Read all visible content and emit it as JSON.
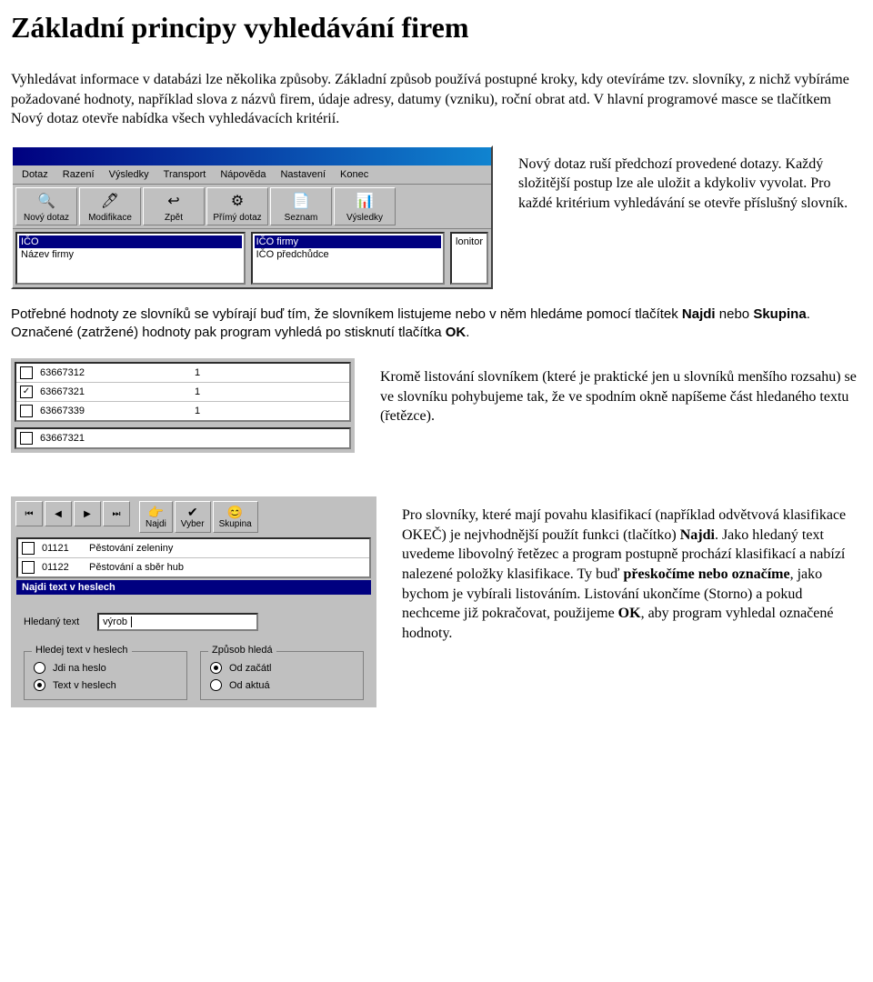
{
  "title": "Základní principy vyhledávání firem",
  "intro": "Vyhledávat informace v databázi lze několika způsoby. Základní způsob používá postupné kroky, kdy otevíráme tzv. slovníky, z nichž vybíráme požadované hodnoty, například slova z názvů firem, údaje adresy, datumy (vzniku), roční obrat atd. V hlavní programové masce se tlačítkem Nový dotaz otevře nabídka všech vyhledávacích kritérií.",
  "shot1": {
    "menu": [
      "Dotaz",
      "Razení",
      "Výsledky",
      "Transport",
      "Nápověda",
      "Nastavení",
      "Konec"
    ],
    "buttons": [
      {
        "label": "Nový dotaz",
        "icon": "🔍"
      },
      {
        "label": "Modifikace",
        "icon": "🖊"
      },
      {
        "label": "Zpět",
        "icon": "↩"
      },
      {
        "label": "Přímý dotaz",
        "icon": "⚙"
      },
      {
        "label": "Seznam",
        "icon": "📄"
      },
      {
        "label": "Výsledky",
        "icon": "📊"
      }
    ],
    "left_items": [
      "IČO",
      "Název firmy"
    ],
    "mid_items": [
      "IČO firmy",
      "IČO předchůdce"
    ],
    "right_items": [
      "lonitor"
    ]
  },
  "side1": "Nový dotaz ruší předchozí provedené dotazy. Každý složitější postup lze ale uložit a kdykoliv vyvolat. Pro každé kritérium vyhledávání se otevře příslušný slovník.",
  "para2a": "Potřebné hodnoty ze slovníků se vybírají buď tím, že slovníkem listujeme nebo v něm hledáme pomocí tlačítek ",
  "para2b": "Najdi",
  "para2c": " nebo ",
  "para2d": "Skupina",
  "para2e": ". Označené (zatržené) hodnoty pak program vyhledá po stisknutí tlačítka ",
  "para2f": "OK",
  "para2g": ".",
  "shot2": {
    "rows": [
      {
        "chk": false,
        "code": "63667312",
        "val": "1"
      },
      {
        "chk": true,
        "code": "63667321",
        "val": "1"
      },
      {
        "chk": false,
        "code": "63667339",
        "val": "1"
      }
    ],
    "input": "63667321"
  },
  "side2": "Kromě listování slovníkem (které je praktické jen u slovníků menšího rozsahu) se ve slovníku pohybujeme tak, že ve spodním okně napíšeme část hledaného textu (řetězce).",
  "shot3": {
    "nav_small": [
      "⏮",
      "◀",
      "▶",
      "⏭"
    ],
    "nav_big": [
      {
        "label": "Najdi",
        "icon": "👉"
      },
      {
        "label": "Vyber",
        "icon": "✔"
      },
      {
        "label": "Skupina",
        "icon": "😊"
      }
    ],
    "rows": [
      {
        "chk": false,
        "code": "01121",
        "txt": "Pěstování zeleniny"
      },
      {
        "chk": false,
        "code": "01122",
        "txt": "Pěstování a sběr hub"
      }
    ],
    "dlg_title": "Najdi text v heslech",
    "search_label": "Hledaný text",
    "search_value": "výrob",
    "group1": {
      "legend": "Hledej text v heslech",
      "opt1": "Jdi na heslo",
      "opt2": "Text v heslech"
    },
    "group2": {
      "legend": "Způsob hledá",
      "opt1": "Od začátl",
      "opt2": "Od aktuá"
    }
  },
  "side3a": "Pro slovníky, které mají povahu klasifikací (například odvětvová klasifikace OKEČ) je nejvhodnější použít funkci (tlačítko) ",
  "side3b": "Najdi",
  "side3c": ". Jako hledaný text uvedeme libovolný řetězec a program postupně prochází klasifikací a nabízí nalezené položky klasifikace. Ty buď ",
  "side3d": "přeskočíme nebo označíme",
  "side3e": ", jako bychom je vybírali listováním. Listování ukončíme (Storno) a pokud nechceme již pokračovat, použijeme ",
  "side3f": "OK",
  "side3g": ", aby program vyhledal označené hodnoty."
}
